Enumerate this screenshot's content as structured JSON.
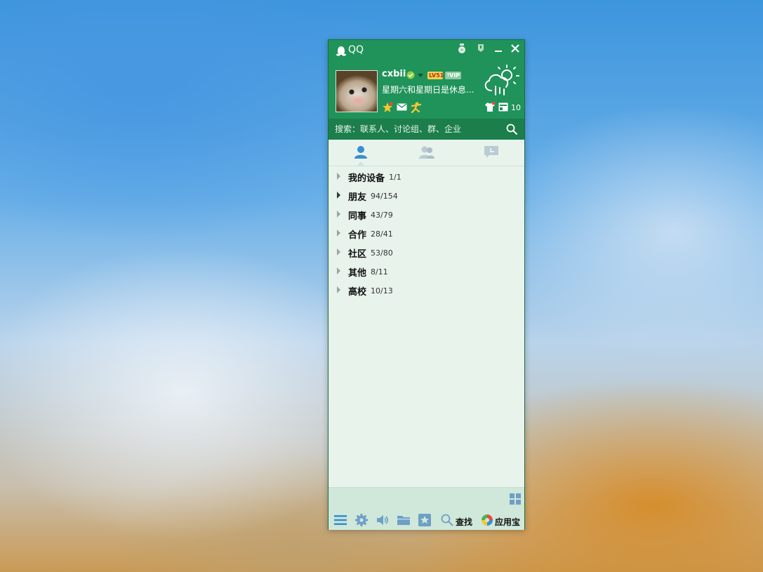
{
  "window": {
    "title": "QQ"
  },
  "profile": {
    "nickname": "cxbii",
    "level_badge": "LV51",
    "vip_badge": "VIP",
    "signature": "星期六和星期日是休息...",
    "skin_count": "10",
    "weather_icon": "cloud-sun-rain-icon"
  },
  "search": {
    "placeholder": "搜索：联系人、讨论组、群、企业"
  },
  "tabs": [
    {
      "name": "contacts",
      "icon": "person-icon",
      "active": true
    },
    {
      "name": "groups",
      "icon": "group-people-icon",
      "active": false
    },
    {
      "name": "recent-messages",
      "icon": "chat-bubble-icon",
      "active": false
    }
  ],
  "groups": [
    {
      "name": "我的设备",
      "count": "1/1"
    },
    {
      "name": "朋友",
      "count": "94/154"
    },
    {
      "name": "同事",
      "count": "43/79"
    },
    {
      "name": "合作",
      "count": "28/41"
    },
    {
      "name": "社区",
      "count": "53/80"
    },
    {
      "name": "其他",
      "count": "8/11"
    },
    {
      "name": "高校",
      "count": "10/13"
    }
  ],
  "bottom_bar": {
    "find_label": "查找",
    "app_store_label": "应用宝"
  },
  "colors": {
    "header_green": "#20935a",
    "search_green": "#1b7e4b",
    "list_bg": "#e8f3ec",
    "bottom_bg": "#cfe8da",
    "icon_blue": "#3a8ed0"
  }
}
